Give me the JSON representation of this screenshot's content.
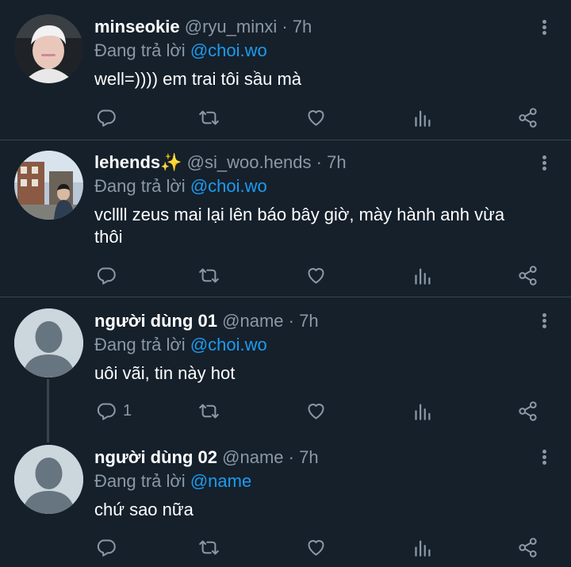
{
  "colors": {
    "background": "#15202b",
    "accent": "#1d9bf0",
    "muted": "#8b98a5",
    "divider": "#38444d"
  },
  "replying_prefix": "Đang trả lời",
  "tweets": [
    {
      "name": "minseokie",
      "handle": "@ryu_minxi",
      "separator": "·",
      "time": "7h",
      "replying_to": "@choi.wo",
      "text": "well=)))) em trai tôi sầu mà",
      "reply_count": ""
    },
    {
      "name": "lehends✨",
      "handle": "@si_woo.hends",
      "separator": "·",
      "time": "7h",
      "replying_to": "@choi.wo",
      "text": "vcllll zeus mai lại lên báo bây giờ, mày hành anh vừa thôi",
      "reply_count": ""
    },
    {
      "name": "người dùng 01",
      "handle": "@name",
      "separator": "·",
      "time": "7h",
      "replying_to": "@choi.wo",
      "text": "uôi vãi, tin này hot",
      "reply_count": "1"
    },
    {
      "name": "người dùng 02",
      "handle": "@name",
      "separator": "·",
      "time": "7h",
      "replying_to": "@name",
      "text": "chứ sao nữa",
      "reply_count": ""
    }
  ],
  "icons": {
    "reply": "reply-icon",
    "retweet": "retweet-icon",
    "like": "heart-icon",
    "analytics": "analytics-icon",
    "share": "share-icon",
    "more": "more-vertical-icon"
  }
}
